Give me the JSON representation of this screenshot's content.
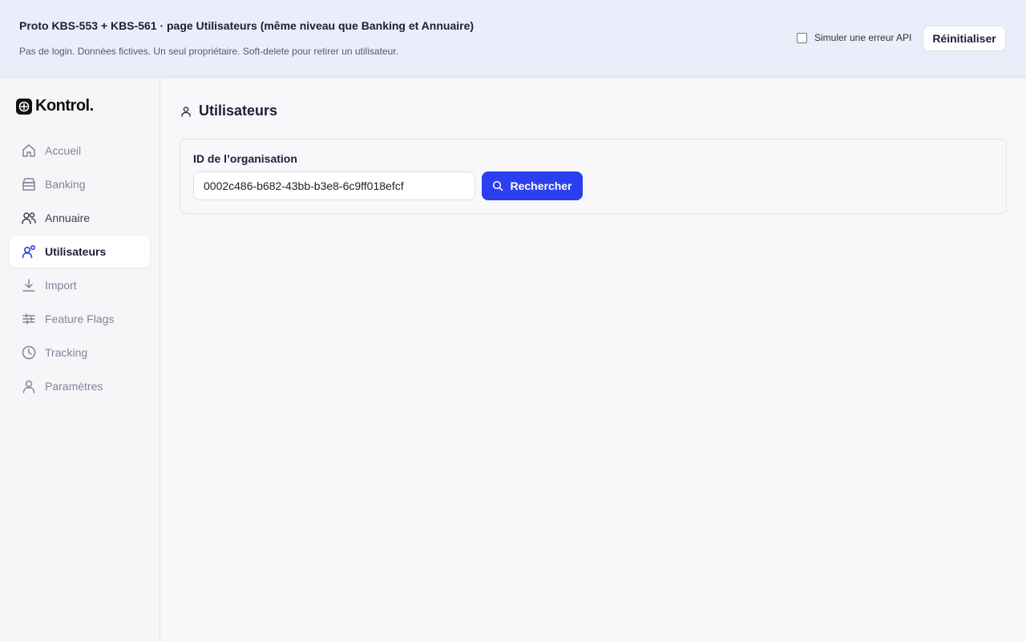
{
  "banner": {
    "title": "Proto KBS-553 + KBS-561 · page Utilisateurs (même niveau que Banking et Annuaire)",
    "subtitle": "Pas de login. Données fictives. Un seul propriétaire. Soft-delete pour retirer un utilisateur.",
    "simulate_error_label": "Simuler une erreur API",
    "simulate_error_checked": false,
    "reset_label": "Réinitialiser"
  },
  "sidebar": {
    "logo_text": "Kontrol.",
    "items": [
      {
        "label": "Accueil",
        "icon": "home-icon"
      },
      {
        "label": "Banking",
        "icon": "bank-icon"
      },
      {
        "label": "Annuaire",
        "icon": "users-icon"
      },
      {
        "label": "Utilisateurs",
        "icon": "user-accounts-icon",
        "active": true
      },
      {
        "label": "Import",
        "icon": "download-icon"
      },
      {
        "label": "Feature Flags",
        "icon": "sliders-icon"
      },
      {
        "label": "Tracking",
        "icon": "clock-icon"
      },
      {
        "label": "Paramètres",
        "icon": "user-icon"
      }
    ]
  },
  "main": {
    "title": "Utilisateurs",
    "title_icon": "user-icon",
    "org_label": "ID de l’organisation",
    "org_value": "0002c486-b682-43bb-b3e8-6c9ff018efcf",
    "search_label": "Rechercher",
    "search_icon": "search-icon"
  },
  "colors": {
    "accent": "#2b3ff0",
    "banner_bg": "#ebedfb",
    "sidebar_bg": "#f6f6f8"
  }
}
